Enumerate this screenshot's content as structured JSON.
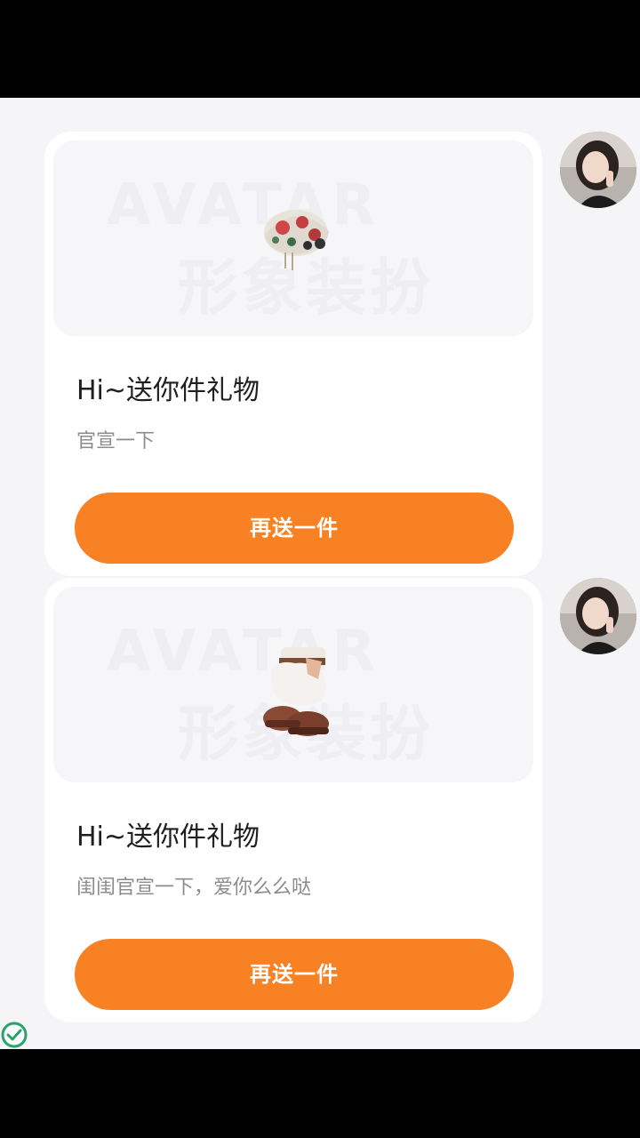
{
  "messages": [
    {
      "gift_name": "hat-icon",
      "title": "Hi~送你件礼物",
      "subtitle": "官宣一下",
      "button_label": "再送一件",
      "watermark_en": "AVATAR",
      "watermark_zh": "形象装扮"
    },
    {
      "gift_name": "boots-icon",
      "title": "Hi~送你件礼物",
      "subtitle": "闺闺官宣一下，爱你么么哒",
      "button_label": "再送一件",
      "watermark_en": "AVATAR",
      "watermark_zh": "形象装扮"
    }
  ],
  "colors": {
    "accent": "#f88123",
    "background": "#f5f5f7",
    "card": "#ffffff",
    "title": "#1f1f1f",
    "subtitle": "#8c8c8c"
  },
  "status_icon": "check-circle-icon"
}
